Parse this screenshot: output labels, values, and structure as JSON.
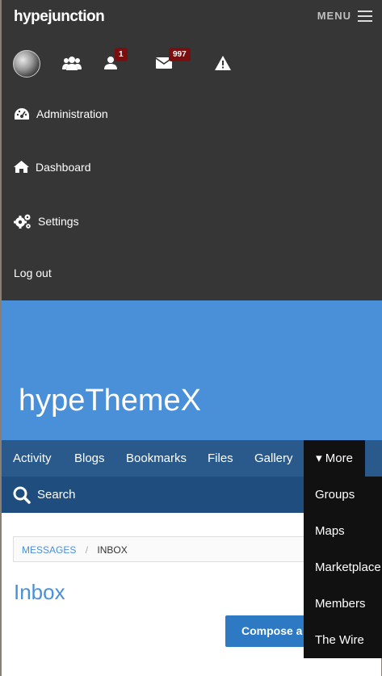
{
  "header": {
    "logo_text": "hypejunction",
    "menu_label": "MENU"
  },
  "icon_bar": {
    "friends_badge": "1",
    "messages_badge": "997"
  },
  "sidebar": {
    "items": [
      {
        "label": "Administration",
        "icon": "dashboard-gauge-icon"
      },
      {
        "label": "Dashboard",
        "icon": "home-icon"
      },
      {
        "label": "Settings",
        "icon": "cogs-icon"
      },
      {
        "label": "Log out",
        "icon": ""
      }
    ]
  },
  "hero": {
    "title": "hypeThemeX"
  },
  "nav": {
    "items": [
      "Activity",
      "Blogs",
      "Bookmarks",
      "Files",
      "Gallery"
    ],
    "more_label": "▾ More"
  },
  "search": {
    "label": "Search"
  },
  "dropdown": {
    "items": [
      "Groups",
      "Maps",
      "Marketplace",
      "Members",
      "The Wire"
    ]
  },
  "breadcrumb": {
    "link": "MESSAGES",
    "separator": "/",
    "current": "INBOX"
  },
  "page": {
    "title": "Inbox",
    "compose_label": "Compose a message"
  },
  "colors": {
    "top_panel": "#363636",
    "hero": "#4a90d9",
    "nav": "#2a5a8c",
    "search_bar": "#1f4e7e",
    "dropdown": "#111111",
    "badge": "#7a0f0f",
    "accent": "#2e79c4"
  }
}
